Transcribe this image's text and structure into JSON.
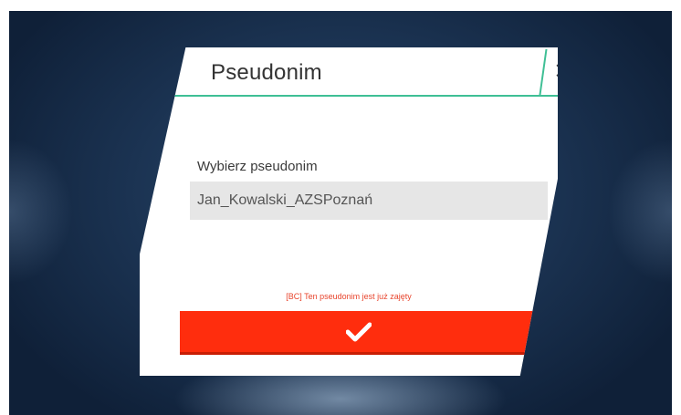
{
  "dialog": {
    "title": "Pseudonim",
    "close_icon": "close-icon",
    "field_label": "Wybierz pseudonim",
    "field_value": "Jan_Kowalski_AZSPoznań",
    "error_text": "[BC] Ten pseudonim jest już zajęty",
    "confirm_icon": "checkmark-icon"
  },
  "colors": {
    "accent_green": "#3fbf95",
    "confirm_red": "#ff2d0d",
    "error_red": "#e8442c",
    "background_navy": "#1b3352"
  }
}
